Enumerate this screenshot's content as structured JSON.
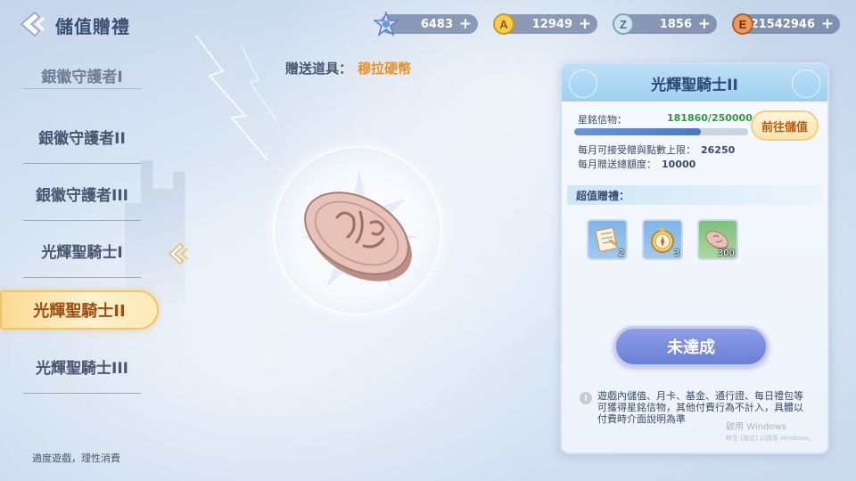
{
  "header": {
    "title": "儲值贈禮",
    "currencies": [
      {
        "icon": "star-crystal-icon",
        "value": "6483",
        "plus": "+"
      },
      {
        "icon": "a-coin-icon",
        "value": "12949",
        "plus": "+"
      },
      {
        "icon": "z-coin-icon",
        "value": "1856",
        "plus": "+"
      },
      {
        "icon": "e-coin-icon",
        "value": "21542946",
        "plus": "+"
      }
    ]
  },
  "tiers": [
    {
      "label": "銀徽守護者I"
    },
    {
      "label": "銀徽守護者II"
    },
    {
      "label": "銀徽守護者III"
    },
    {
      "label": "光輝聖騎士I"
    },
    {
      "label": "光輝聖騎士II"
    },
    {
      "label": "光輝聖騎士III"
    }
  ],
  "selected_tier_index": 4,
  "footer_note": "適度遊戲，理性消費",
  "gift": {
    "label": "贈送道具：",
    "item_name": "穆拉硬幣"
  },
  "panel": {
    "title": "光輝聖騎士II",
    "stat_label": "星銘信物：",
    "stat_value": "181860/250000",
    "progress": 0.727,
    "topup_label": "前往儲值",
    "monthly_limit_label": "每月可接受贈與點數上限：",
    "monthly_limit_value": "26250",
    "monthly_total_label": "每月贈送總額度：",
    "monthly_total_value": "10000",
    "bonus_label": "超值贈禮：",
    "rewards": [
      {
        "icon": "scroll-document-icon",
        "qty": "2"
      },
      {
        "icon": "gold-compass-icon",
        "qty": "3"
      },
      {
        "icon": "mura-coin-icon",
        "qty": "300"
      }
    ],
    "status_label": "未達成",
    "notice": "遊戲內儲值、月卡、基金、通行證、每日禮包等可獲得星銘信物，其他付費行為不計入，具體以付費時介面說明為準",
    "watermark_line1": "啟用 Windows",
    "watermark_line2": "移至 [設定] 以啟用 Windows。"
  },
  "colors": {
    "accent_orange": "#e8912c",
    "progress_green": "#2e9e3a",
    "status_button": "#7a8ddf",
    "selected_tier": "#fbd98f"
  }
}
